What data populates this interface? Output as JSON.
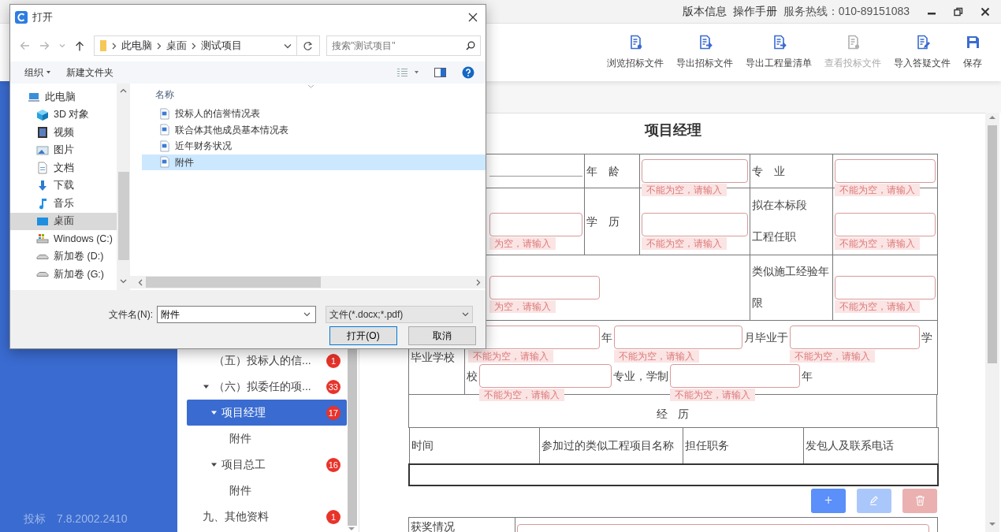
{
  "title_bar": {
    "items": [
      {
        "kind": "link",
        "text": "版本信息"
      },
      {
        "kind": "link",
        "text": "操作手册"
      },
      {
        "kind": "text",
        "text": "服务热线：010-89151083"
      }
    ]
  },
  "toolbar": [
    {
      "label": "浏览招标文件",
      "kind": "view",
      "disabled": false
    },
    {
      "label": "导出招标文件",
      "kind": "export",
      "disabled": false
    },
    {
      "label": "导出工程量清单",
      "kind": "export",
      "disabled": false
    },
    {
      "label": "查看投标文件",
      "kind": "view",
      "disabled": true
    },
    {
      "label": "导入答疑文件",
      "kind": "import",
      "disabled": false
    },
    {
      "label": "保存",
      "kind": "save",
      "disabled": false
    }
  ],
  "sidebar": {
    "product": "投标",
    "version": "7.8.2002.2410"
  },
  "tree": {
    "items": [
      {
        "label": "（五）投标人的信...",
        "badge": "1",
        "selected": false
      },
      {
        "label": "（六）拟委任的项...",
        "badge": "33",
        "selected": false,
        "expanded": true,
        "children": [
          {
            "label": "项目经理",
            "badge": "17",
            "selected": true,
            "expanded": true,
            "children": [
              {
                "label": "附件",
                "selected": false
              }
            ]
          },
          {
            "label": "项目总工",
            "badge": "16",
            "selected": false,
            "expanded": true,
            "children": [
              {
                "label": "附件",
                "selected": false
              }
            ]
          }
        ]
      }
    ],
    "top_level_items": [
      {
        "label": "九、其他资料",
        "badge": "1",
        "selected": false
      }
    ]
  },
  "form": {
    "title": "项目经理",
    "grid_rows": [
      [
        {
          "kind": "line"
        },
        {
          "kind": "label",
          "text": "年 龄"
        },
        {
          "kind": "field",
          "error": "不能为空，请输入"
        },
        {
          "kind": "label",
          "text": "专 业"
        },
        {
          "kind": "field",
          "error": "不能为空，请输入"
        }
      ],
      [
        {
          "kind": "field",
          "error": "为空，请输入"
        },
        {
          "kind": "label",
          "text": "学 历"
        },
        {
          "kind": "field",
          "error": "不能为空，请输入"
        },
        {
          "kind": "label",
          "lines": [
            "拟在本标段",
            "工程任职"
          ]
        },
        {
          "kind": "field",
          "error": "不能为空，请输入"
        }
      ],
      [
        {
          "kind": "field",
          "error": "为空，请输入"
        },
        {
          "kind": "label",
          "lines": [
            "类似施工经验年",
            "限"
          ]
        },
        {
          "kind": "field",
          "error": "不能为空，请输入"
        }
      ]
    ],
    "graduation": {
      "label": "毕业学校",
      "lines": [
        [
          {
            "kind": "field",
            "error": "不能为空，请输入"
          },
          {
            "kind": "text",
            "text": "年"
          },
          {
            "kind": "field",
            "error": "不能为空，请输入"
          },
          {
            "kind": "text",
            "text": "月毕业于"
          },
          {
            "kind": "field",
            "error": "不能为空，请输入"
          },
          {
            "kind": "text",
            "text": "学"
          }
        ],
        [
          {
            "kind": "text",
            "text": "校"
          },
          {
            "kind": "field",
            "error": "不能为空，请输入"
          },
          {
            "kind": "text",
            "text": "专业，学制"
          },
          {
            "kind": "field",
            "error": "不能为空，请输入"
          },
          {
            "kind": "text",
            "text": "年"
          }
        ]
      ]
    },
    "experience": {
      "heading": "经 历",
      "columns": [
        "时间",
        "参加过的类似工程项目名称",
        "担任职务",
        "发包人及联系电话"
      ]
    },
    "row_buttons": [
      {
        "kind": "add",
        "label": "+",
        "disabled": false
      },
      {
        "kind": "edit",
        "disabled": true
      },
      {
        "kind": "delete",
        "disabled": true
      }
    ],
    "awards": {
      "label": "获奖情况"
    }
  },
  "dialog": {
    "title": "打开",
    "path": [
      "此电脑",
      "桌面",
      "测试项目"
    ],
    "search": {
      "placeholder": "搜索\"测试项目\""
    },
    "commands": [
      {
        "label": "组织",
        "menu": true
      },
      {
        "label": "新建文件夹",
        "menu": false
      }
    ],
    "nav": [
      {
        "label": "此电脑",
        "kind": "computer",
        "selected": false
      },
      {
        "label": "3D 对象",
        "kind": "cube",
        "selected": false
      },
      {
        "label": "视频",
        "kind": "film",
        "selected": false
      },
      {
        "label": "图片",
        "kind": "picture",
        "selected": false
      },
      {
        "label": "文档",
        "kind": "document",
        "selected": false
      },
      {
        "label": "下载",
        "kind": "download",
        "selected": false
      },
      {
        "label": "音乐",
        "kind": "music",
        "selected": false
      },
      {
        "label": "桌面",
        "kind": "desktop",
        "selected": true
      },
      {
        "label": "Windows (C:)",
        "kind": "drive_windows",
        "selected": false
      },
      {
        "label": "新加卷 (D:)",
        "kind": "drive",
        "selected": false
      },
      {
        "label": "新加卷 (G:)",
        "kind": "drive",
        "selected": false
      }
    ],
    "column_header": "名称",
    "files": [
      {
        "name": "投标人的信誉情况表",
        "selected": false
      },
      {
        "name": "联合体其他成员基本情况表",
        "selected": false
      },
      {
        "name": "近年财务状况",
        "selected": false
      },
      {
        "name": "附件",
        "selected": true
      }
    ],
    "file_name": {
      "label": "文件名(N):",
      "value": "附件"
    },
    "file_type": "文件(*.docx;*.pdf)",
    "buttons": [
      {
        "label": "打开(O)",
        "primary": true
      },
      {
        "label": "取消",
        "primary": false
      }
    ]
  }
}
